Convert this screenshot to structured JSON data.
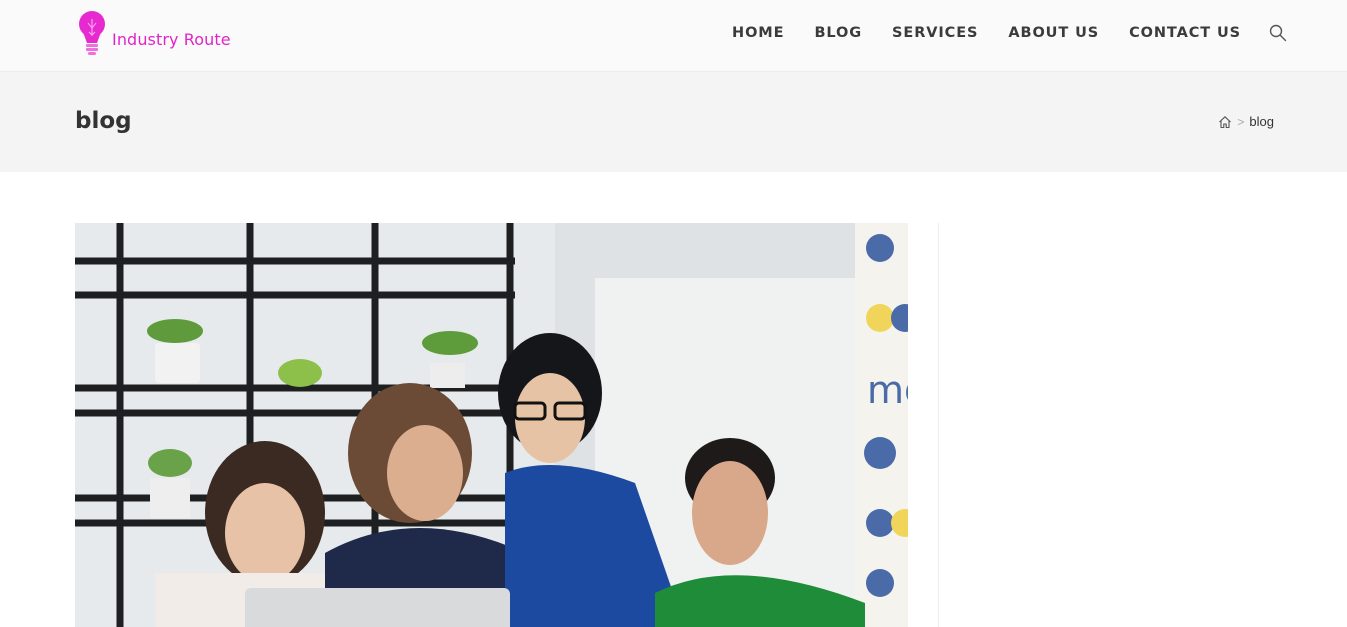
{
  "brand": {
    "name": "Industry Route",
    "logo_color": "#e025c8"
  },
  "nav": {
    "items": [
      {
        "label": "HOME"
      },
      {
        "label": "BLOG"
      },
      {
        "label": "SERVICES"
      },
      {
        "label": "ABOUT US"
      },
      {
        "label": "CONTACT US"
      }
    ],
    "search_icon": "search-icon"
  },
  "page": {
    "title": "blog"
  },
  "breadcrumb": {
    "home_icon": "home-icon",
    "separator": ">",
    "current": "blog"
  },
  "featured_image": {
    "icon": "photo-of-team-around-laptop"
  },
  "colors": {
    "header_bg": "#fafafa",
    "title_bar_bg": "#f4f4f4",
    "text": "#333333",
    "accent": "#e025c8"
  }
}
